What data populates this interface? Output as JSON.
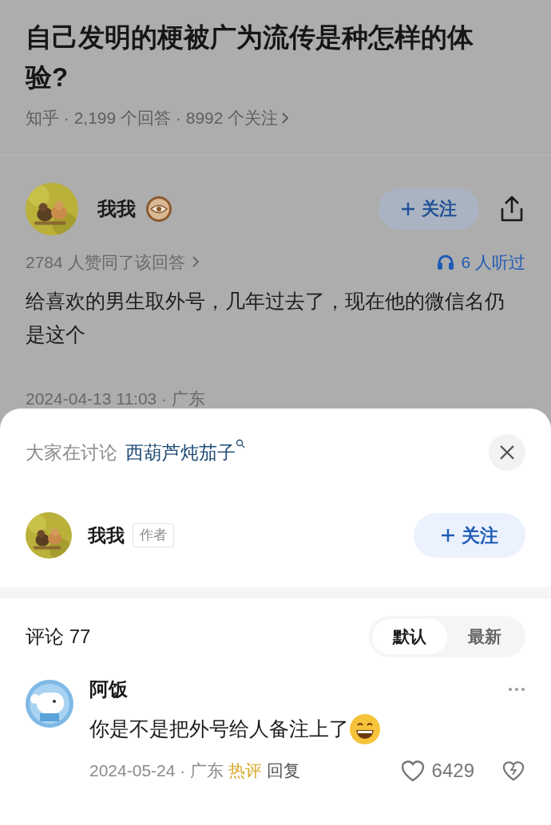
{
  "question": {
    "title": "自己发明的梗被广为流传是种怎样的体验?",
    "meta": "知乎 · 2,199 个回答 · 8992 个关注"
  },
  "answer": {
    "author": "我我",
    "follow": "关注",
    "agree": "2784 人赞同了该回答",
    "listened": "6 人听过",
    "body": "给喜欢的男生取外号，几年过去了，现在他的微信名仍是这个",
    "date": "2024-04-13 11:03 · 广东"
  },
  "sheet": {
    "discussing": "大家在讨论",
    "topic": "西葫芦炖茄子",
    "author": "我我",
    "badge": "作者",
    "follow": "关注"
  },
  "comments": {
    "header": "评论 77",
    "sort_tabs": [
      {
        "label": "默认",
        "selected": true
      },
      {
        "label": "最新",
        "selected": false
      }
    ],
    "items": [
      {
        "author": "阿饭",
        "text": "你是不是把外号给人备注上了",
        "date": "2024-05-24 · 广东",
        "tag": "热评",
        "reply": "回复",
        "likes": "6429"
      }
    ]
  }
}
